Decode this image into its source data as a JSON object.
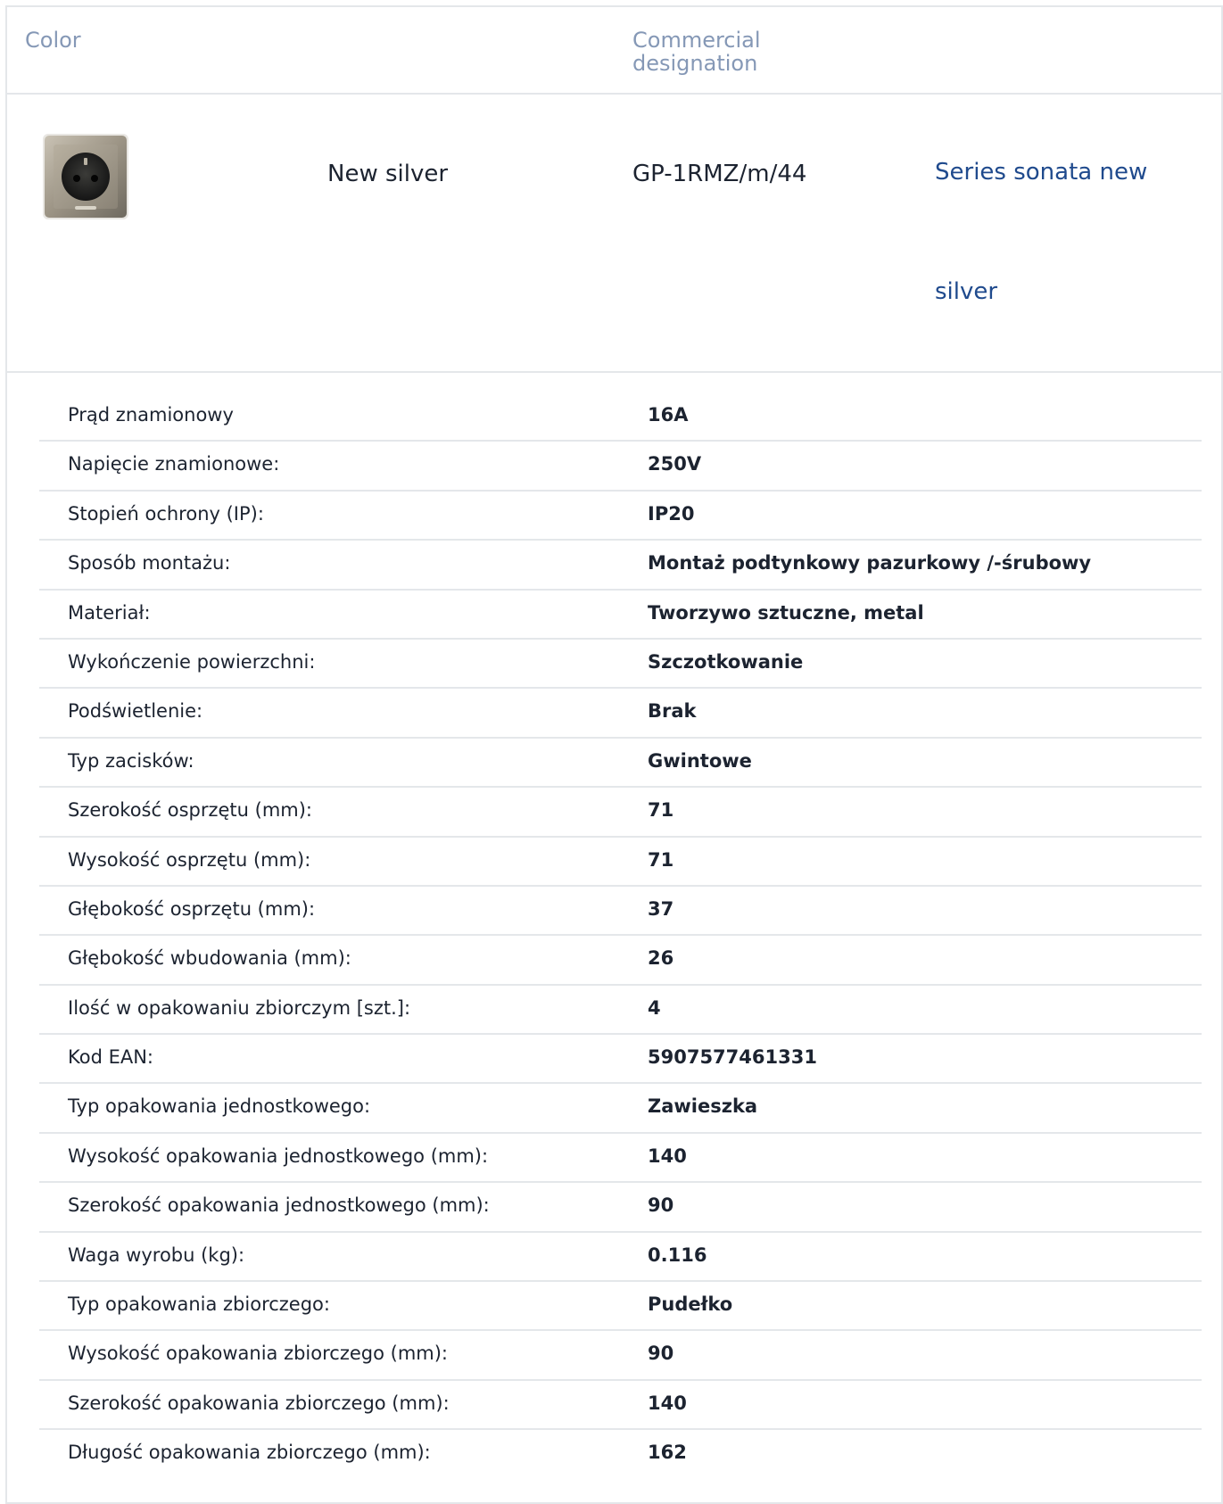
{
  "header": {
    "color_label": "Color",
    "designation_label": "Commercial designation"
  },
  "product": {
    "image_icon": "power-socket-icon",
    "color": "New silver",
    "code": "GP-1RMZ/m/44",
    "series_link": "Series sonata new silver"
  },
  "specs": [
    {
      "label": "Prąd znamionowy",
      "value": "16A"
    },
    {
      "label": "Napięcie znamionowe:",
      "value": "250V"
    },
    {
      "label": "Stopień ochrony (IP):",
      "value": "IP20"
    },
    {
      "label": "Sposób montażu:",
      "value": "Montaż podtynkowy pazurkowy /-śrubowy"
    },
    {
      "label": "Materiał:",
      "value": "Tworzywo sztuczne, metal"
    },
    {
      "label": "Wykończenie powierzchni:",
      "value": "Szczotkowanie"
    },
    {
      "label": "Podświetlenie:",
      "value": "Brak"
    },
    {
      "label": "Typ zacisków:",
      "value": "Gwintowe"
    },
    {
      "label": "Szerokość osprzętu (mm):",
      "value": "71"
    },
    {
      "label": "Wysokość osprzętu (mm):",
      "value": "71"
    },
    {
      "label": "Głębokość osprzętu (mm):",
      "value": "37"
    },
    {
      "label": "Głębokość wbudowania (mm):",
      "value": "26"
    },
    {
      "label": "Ilość w opakowaniu zbiorczym [szt.]:",
      "value": "4"
    },
    {
      "label": "Kod EAN:",
      "value": "5907577461331"
    },
    {
      "label": "Typ opakowania jednostkowego:",
      "value": "Zawieszka"
    },
    {
      "label": "Wysokość opakowania jednostkowego (mm):",
      "value": "140"
    },
    {
      "label": "Szerokość opakowania jednostkowego (mm):",
      "value": "90"
    },
    {
      "label": "Waga wyrobu (kg):",
      "value": "0.116"
    },
    {
      "label": "Typ opakowania zbiorczego:",
      "value": "Pudełko"
    },
    {
      "label": "Wysokość opakowania zbiorczego (mm):",
      "value": "90"
    },
    {
      "label": "Szerokość opakowania zbiorczego (mm):",
      "value": "140"
    },
    {
      "label": "Długość opakowania zbiorczego (mm):",
      "value": "162"
    }
  ],
  "colors": {
    "link": "#1f4a8d",
    "header_text": "#8598b6",
    "border": "#e4e7ea"
  }
}
